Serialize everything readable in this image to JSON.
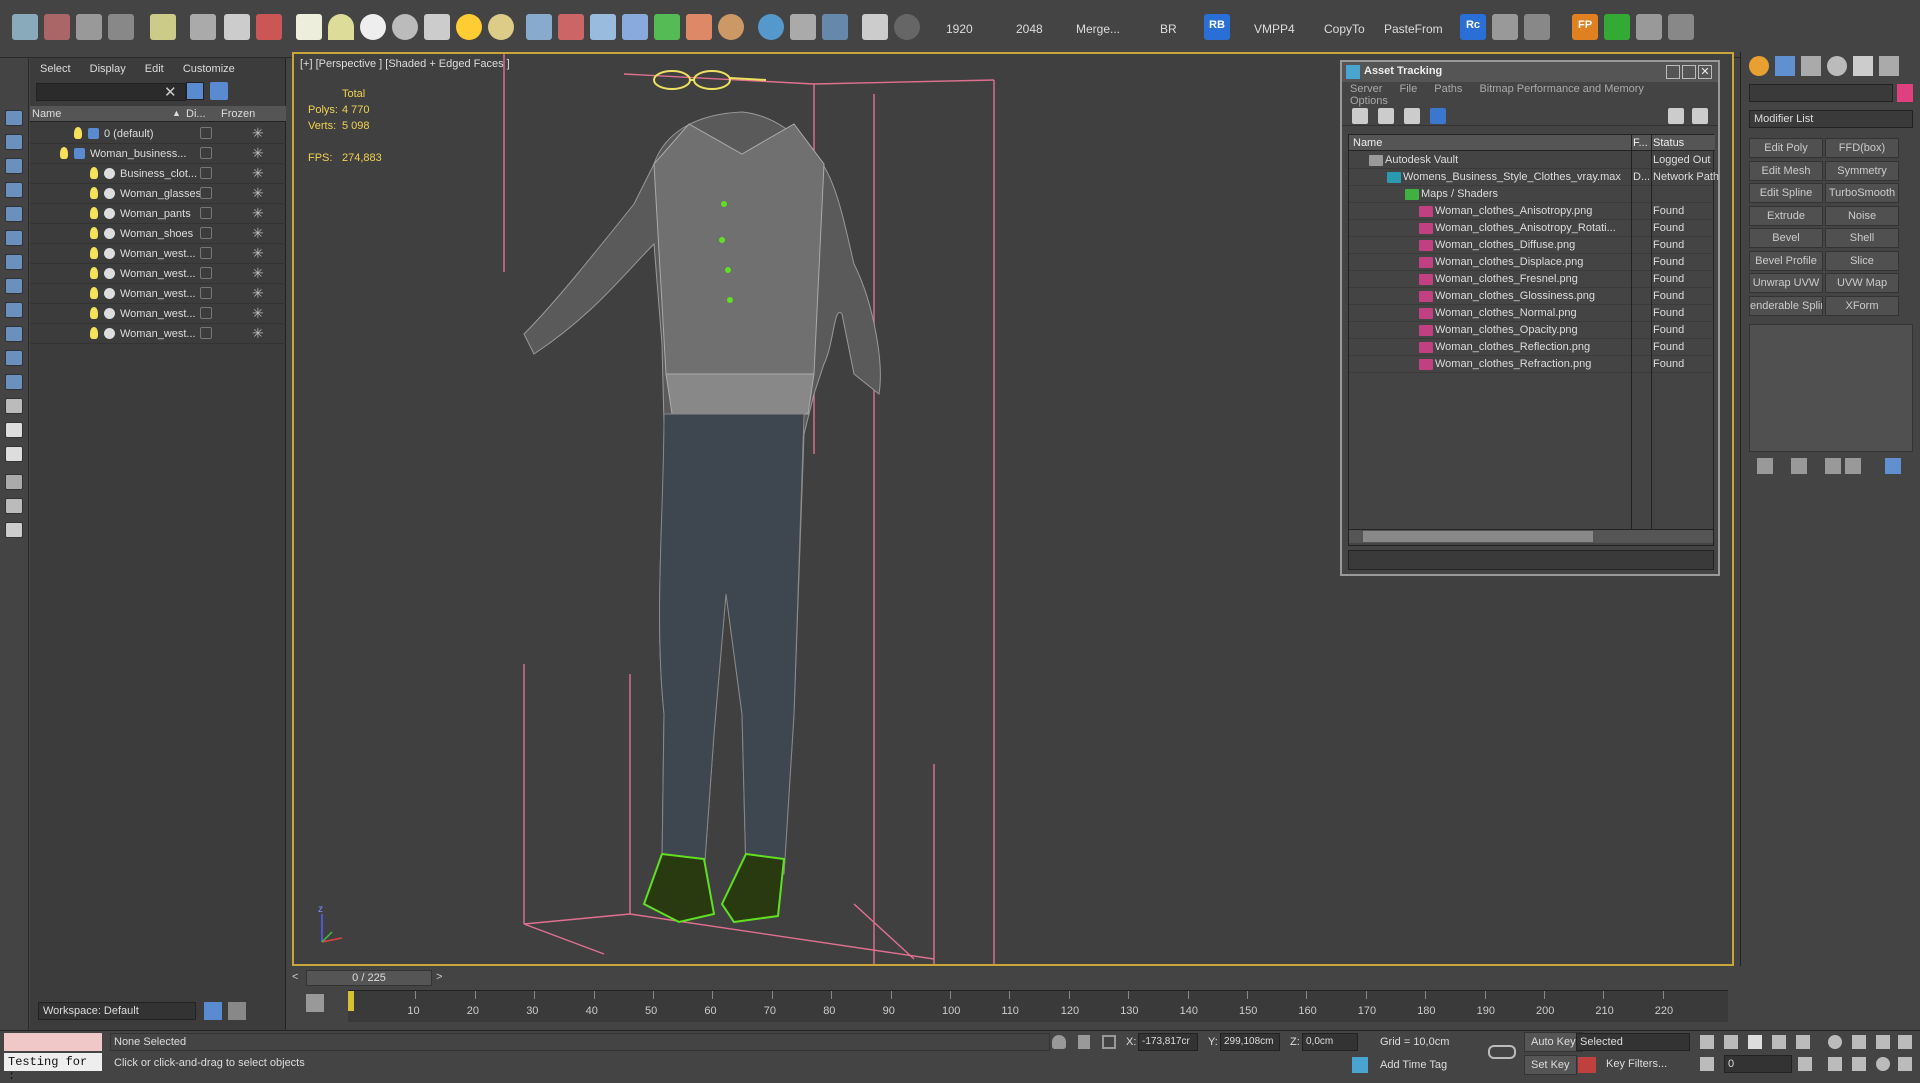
{
  "toolbar": {
    "labels": [
      "1920",
      "2048",
      "Merge...",
      "BR",
      "VMPP4",
      "CopyTo",
      "PasteFrom"
    ],
    "rb_label": "RB",
    "rc_label": "Rc",
    "fp_label": "FP"
  },
  "scene_explorer": {
    "menu": [
      "Select",
      "Display",
      "Edit",
      "Customize"
    ],
    "col_name": "Name",
    "col_display": "Di...",
    "col_frozen": "Frozen",
    "rows": [
      {
        "label": "0 (default)"
      },
      {
        "label": "Woman_business..."
      },
      {
        "label": "Business_clot..."
      },
      {
        "label": "Woman_glasses"
      },
      {
        "label": "Woman_pants"
      },
      {
        "label": "Woman_shoes"
      },
      {
        "label": "Woman_west..."
      },
      {
        "label": "Woman_west..."
      },
      {
        "label": "Woman_west..."
      },
      {
        "label": "Woman_west..."
      },
      {
        "label": "Woman_west..."
      }
    ],
    "workspace": "Workspace: Default"
  },
  "viewport": {
    "label": "[+] [Perspective ] [Shaded + Edged Faces ]",
    "total": "Total",
    "polys_label": "Polys:",
    "polys": "4 770",
    "verts_label": "Verts:",
    "verts": "5 098",
    "fps_label": "FPS:",
    "fps": "274,883",
    "axis_z": "z"
  },
  "asset_tracking": {
    "title": "Asset Tracking",
    "menu": [
      "Server",
      "File",
      "Paths",
      "Bitmap Performance and Memory",
      "Options"
    ],
    "col_name": "Name",
    "col_f": "F...",
    "col_status": "Status",
    "rows": [
      {
        "name": "Autodesk Vault",
        "f": "",
        "status": "Logged Out"
      },
      {
        "name": "Womens_Business_Style_Clothes_vray.max",
        "f": "D...",
        "status": "Network Path"
      },
      {
        "name": "Maps / Shaders",
        "f": "",
        "status": ""
      },
      {
        "name": "Woman_clothes_Anisotropy.png",
        "f": "",
        "status": "Found"
      },
      {
        "name": "Woman_clothes_Anisotropy_Rotati...",
        "f": "",
        "status": "Found"
      },
      {
        "name": "Woman_clothes_Diffuse.png",
        "f": "",
        "status": "Found"
      },
      {
        "name": "Woman_clothes_Displace.png",
        "f": "",
        "status": "Found"
      },
      {
        "name": "Woman_clothes_Fresnel.png",
        "f": "",
        "status": "Found"
      },
      {
        "name": "Woman_clothes_Glossiness.png",
        "f": "",
        "status": "Found"
      },
      {
        "name": "Woman_clothes_Normal.png",
        "f": "",
        "status": "Found"
      },
      {
        "name": "Woman_clothes_Opacity.png",
        "f": "",
        "status": "Found"
      },
      {
        "name": "Woman_clothes_Reflection.png",
        "f": "",
        "status": "Found"
      },
      {
        "name": "Woman_clothes_Refraction.png",
        "f": "",
        "status": "Found"
      }
    ]
  },
  "command_panel": {
    "modifier_list": "Modifier List",
    "buttons": [
      "Edit Poly",
      "FFD(box)",
      "Edit Mesh",
      "Symmetry",
      "Edit Spline",
      "TurboSmooth",
      "Extrude",
      "Noise",
      "Bevel",
      "Shell",
      "Bevel Profile",
      "Slice",
      "Unwrap UVW",
      "UVW Map",
      "enderable Splir",
      "XForm"
    ]
  },
  "timeline": {
    "frame": "0 / 225",
    "ticks": [
      "10",
      "20",
      "30",
      "40",
      "50",
      "60",
      "70",
      "80",
      "90",
      "100",
      "110",
      "120",
      "130",
      "140",
      "150",
      "160",
      "170",
      "180",
      "190",
      "200",
      "210",
      "220"
    ]
  },
  "status_bar": {
    "selection": "None Selected",
    "prompt": "Click or click-and-drag to select objects",
    "maxscript": "Testing for :",
    "x_label": "X:",
    "x": "-173,817cr",
    "y_label": "Y:",
    "y": "299,108cm",
    "z_label": "Z:",
    "z": "0,0cm",
    "grid": "Grid = 10,0cm",
    "add_time_tag": "Add Time Tag",
    "auto_key": "Auto Key",
    "set_key": "Set Key",
    "selected": "Selected",
    "key_filters": "Key Filters...",
    "frame_value": "0"
  }
}
